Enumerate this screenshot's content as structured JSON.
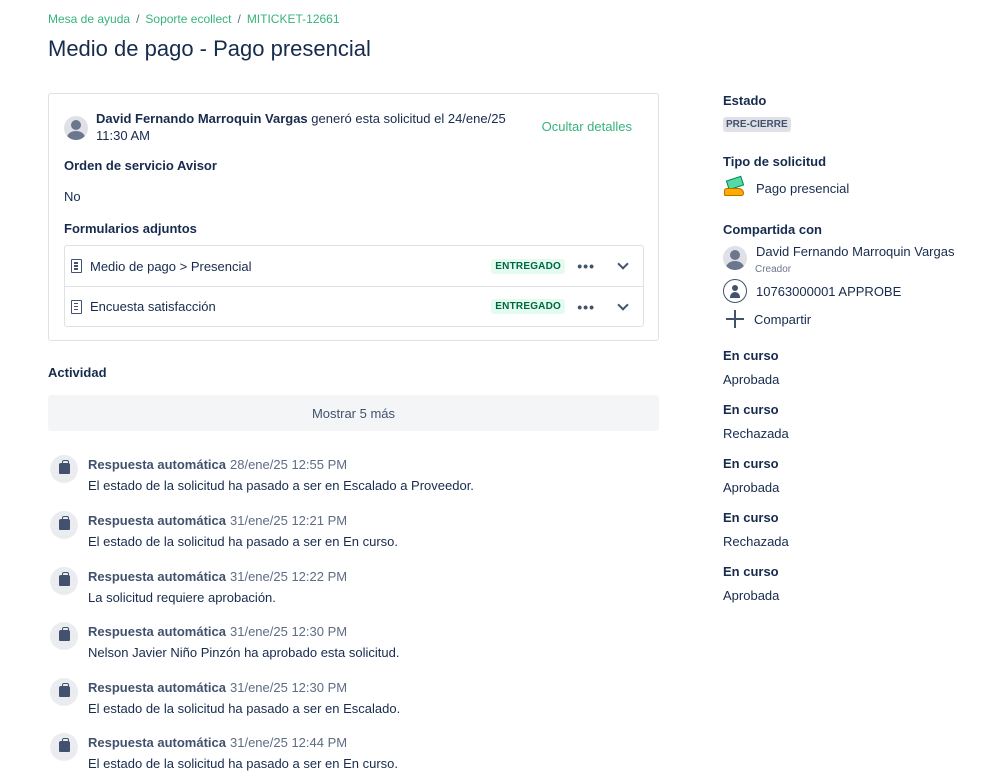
{
  "breadcrumb": {
    "items": [
      "Mesa de ayuda",
      "Soporte ecollect",
      "MITICKET-12661"
    ],
    "separator": "/"
  },
  "page_title": "Medio de pago - Pago presencial",
  "request": {
    "author": "David Fernando Marroquin Vargas",
    "action_text": " generó esta solicitud el 24/ene/25 11:30 AM",
    "hide_details": "Ocultar detalles",
    "field_label": "Orden de servicio Avisor",
    "field_value": "No",
    "forms_label": "Formularios adjuntos",
    "forms": [
      {
        "name": "Medio de pago > Presencial",
        "status": "ENTREGADO"
      },
      {
        "name": "Encuesta satisfacción",
        "status": "ENTREGADO"
      }
    ],
    "more_actions": "•••"
  },
  "activity": {
    "title": "Actividad",
    "show_more": "Mostrar 5 más",
    "items": [
      {
        "author": "Respuesta automática",
        "date": "28/ene/25 12:55 PM",
        "text": "El estado de la solicitud ha pasado a ser en Escalado a Proveedor."
      },
      {
        "author": "Respuesta automática",
        "date": "31/ene/25 12:21 PM",
        "text": "El estado de la solicitud ha pasado a ser en En curso."
      },
      {
        "author": "Respuesta automática",
        "date": "31/ene/25 12:22 PM",
        "text": "La solicitud requiere aprobación."
      },
      {
        "author": "Respuesta automática",
        "date": "31/ene/25 12:30 PM",
        "text": "Nelson Javier Niño Pinzón ha aprobado esta solicitud."
      },
      {
        "author": "Respuesta automática",
        "date": "31/ene/25 12:30 PM",
        "text": "El estado de la solicitud ha pasado a ser en Escalado."
      },
      {
        "author": "Respuesta automática",
        "date": "31/ene/25 12:44 PM",
        "text": "El estado de la solicitud ha pasado a ser en En curso."
      }
    ]
  },
  "sidebar": {
    "status_label": "Estado",
    "status_value": "PRE-CIERRE",
    "type_label": "Tipo de solicitud",
    "type_value": "Pago presencial",
    "shared_label": "Compartida con",
    "shared_user": "David Fernando Marroquin Vargas",
    "shared_user_role": "Creador",
    "shared_org": "10763000001 APPROBE",
    "share_button": "Compartir",
    "approvals": [
      {
        "label": "En curso",
        "value": "Aprobada"
      },
      {
        "label": "En curso",
        "value": "Rechazada"
      },
      {
        "label": "En curso",
        "value": "Aprobada"
      },
      {
        "label": "En curso",
        "value": "Rechazada"
      },
      {
        "label": "En curso",
        "value": "Aprobada"
      }
    ]
  },
  "colors": {
    "link_green": "#36b37e",
    "text_primary": "#172b4d",
    "badge_green_bg": "#e3fcef",
    "badge_green_text": "#006644"
  }
}
